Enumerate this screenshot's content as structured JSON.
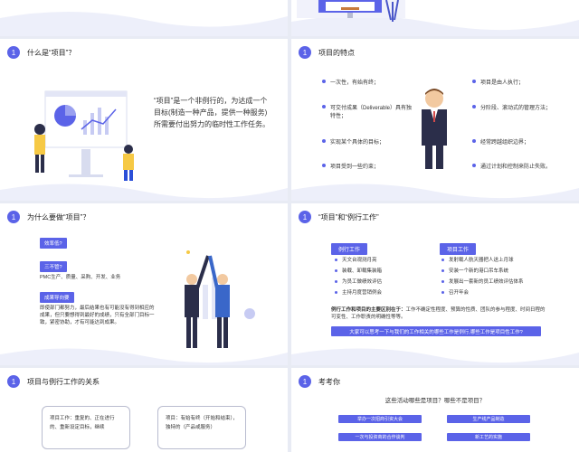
{
  "slide1": {
    "num": "1",
    "title": "什么是“项目”？",
    "paragraph": "“项目”是一个非例行的，为达成一个目标(制造一种产品，提供一种服务)所需要付出努力的临时性工作任务。"
  },
  "slide2": {
    "num": "1",
    "title": "项目的特点",
    "left": [
      "一次性，有始有终；",
      "可交付成果（Deliverable）具有独特性；",
      "实现某个具体的目标；",
      "项目受到一些约束；"
    ],
    "right": [
      "项目是由人执行；",
      "分阶段、滚动式的管理方法；",
      "经常跨越组织边界；",
      "通过计划和控制来防止失败。"
    ]
  },
  "slide3": {
    "num": "1",
    "title": "为什么要做“项目”？",
    "tag1": "效率低?",
    "tag2": "三不管?",
    "line2": "PMC生产、质量、采购、开发、业务",
    "tag3": "成果导向要",
    "para3": "即使部门都努力，最后结果也有可能没有得到相应的成果，但只要想得到最好的成绩，只有全部门目标一致，紧密协助，才有可能达到成果。"
  },
  "slide4": {
    "num": "1",
    "title": "“项目”和“例行工作”",
    "routine_header": "例行工作",
    "project_header": "项目工作",
    "routine": [
      "天文台观测月亮",
      "装载、卸载集装箱",
      "为员工做绩效评估",
      "主持月度营销例会"
    ],
    "project": [
      "发射载人航天器把人送上月球",
      "安装一个新的港口吊车系统",
      "发展出一套新的员工绩效评估体系",
      "召开年会"
    ],
    "note_bold": "例行工作和项目的主要区别在于：",
    "note": "工作不确定性程度、预算的性质、团队的参与程度、时间日程的可变性、工作职责的明确性等等。",
    "bar": "大家可以思考一下与我们的工作相关的哪些工作是例行,哪些工作是项目性工作?"
  },
  "slide5": {
    "num": "1",
    "title": "项目与例行工作的关系",
    "box1": "项目工作：重复的、正在进行的、重新设定目标，继续",
    "box2": "项目：有始有终（开始和结束），独特的（产品或服务）"
  },
  "slide6": {
    "num": "1",
    "title": "考考你",
    "question": "这些活动哪些是项目？哪些不是项目？",
    "options": [
      "举办一次招商引资大会",
      "生产线产品制造",
      "一次与投资商的合作谈判",
      "新工艺的实施"
    ]
  }
}
